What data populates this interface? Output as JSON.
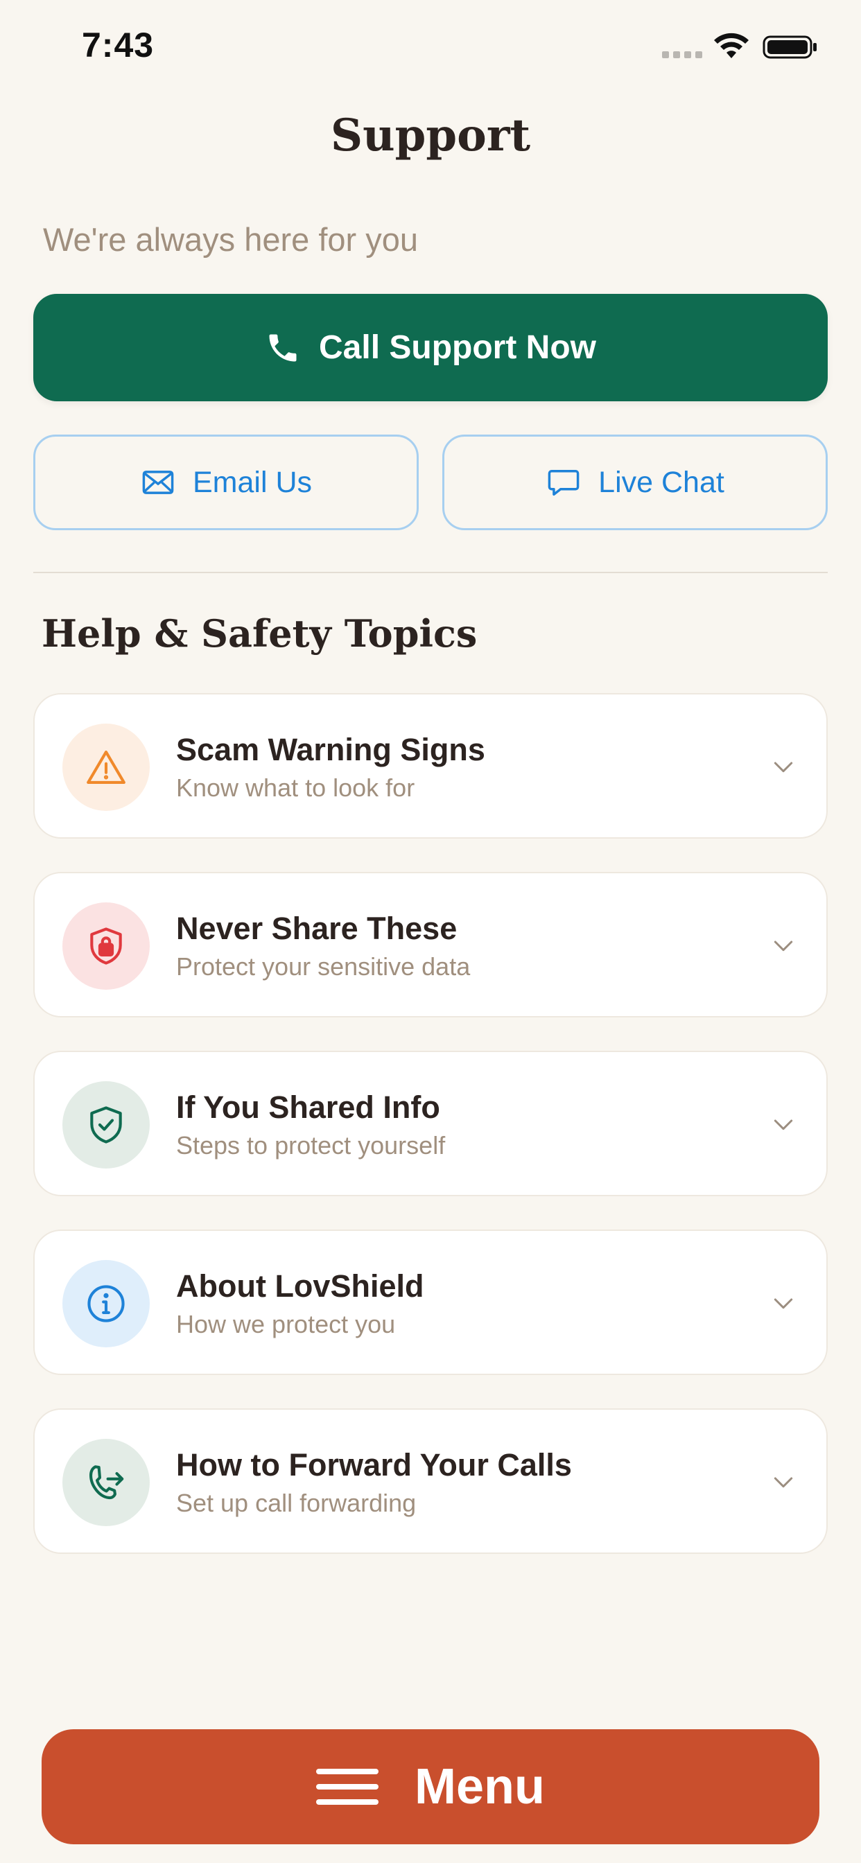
{
  "status_bar": {
    "time": "7:43"
  },
  "header": {
    "title": "Support",
    "subtitle": "We're always here for you"
  },
  "actions": {
    "call_label": "Call Support Now",
    "email_label": "Email Us",
    "chat_label": "Live Chat"
  },
  "section": {
    "title": "Help & Safety Topics"
  },
  "topics": [
    {
      "title": "Scam Warning Signs",
      "subtitle": "Know what to look for",
      "icon": "warning-icon",
      "color": "#f0892b",
      "bg": "#fdeee2"
    },
    {
      "title": "Never Share These",
      "subtitle": "Protect your sensitive data",
      "icon": "shield-lock-icon",
      "color": "#e0393e",
      "bg": "#fbe2e2"
    },
    {
      "title": "If You Shared Info",
      "subtitle": "Steps to protect yourself",
      "icon": "shield-check-icon",
      "color": "#0f6b50",
      "bg": "#e3ece6"
    },
    {
      "title": "About LovShield",
      "subtitle": "How we protect you",
      "icon": "info-icon",
      "color": "#1e82d8",
      "bg": "#dfeefb"
    },
    {
      "title": "How to Forward Your Calls",
      "subtitle": "Set up call forwarding",
      "icon": "phone-forward-icon",
      "color": "#0f6b50",
      "bg": "#e3ece6"
    }
  ],
  "menu": {
    "label": "Menu"
  },
  "colors": {
    "primary_green": "#0f6b50",
    "accent_orange": "#c94f2d",
    "link_blue": "#1e82d8",
    "background": "#f9f6f0"
  }
}
